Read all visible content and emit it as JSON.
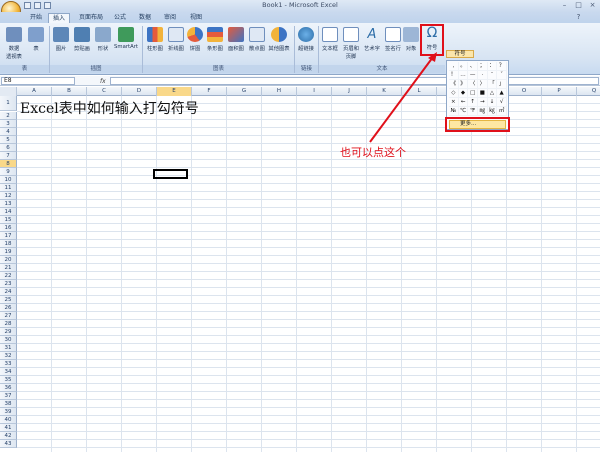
{
  "window": {
    "title": "Book1 - Microsoft Excel"
  },
  "tabs": [
    "开始",
    "插入",
    "页面布局",
    "公式",
    "数据",
    "审阅",
    "视图"
  ],
  "active_tab": "插入",
  "ribbon": {
    "groups": {
      "tables": "表",
      "illustrations": "插图",
      "charts": "图表",
      "links": "链接",
      "text": "文本"
    },
    "buttons": {
      "pivot": "数据\n透视表",
      "table": "表",
      "picture": "图片",
      "clipart": "剪贴画",
      "shapes": "形状",
      "smartart": "SmartArt",
      "column": "柱形图",
      "line": "折线图",
      "pie": "饼图",
      "bar": "条形图",
      "area": "面积图",
      "scatter": "散点图",
      "other_charts": "其他图表",
      "hyperlink": "超链接",
      "textbox": "文本框",
      "header_footer": "页眉和\n页脚",
      "wordart": "艺术字",
      "signature": "签名行",
      "object": "对象",
      "symbol": "符号"
    },
    "symbol_header": "符号"
  },
  "formula_bar": {
    "name_box": "E8",
    "fx": "fx",
    "value": ""
  },
  "columns": [
    "A",
    "B",
    "C",
    "D",
    "E",
    "F",
    "G",
    "H",
    "I",
    "J",
    "K",
    "L",
    "M",
    "N",
    "O",
    "P",
    "Q"
  ],
  "selected_column": "E",
  "rows": [
    "1",
    "2",
    "3",
    "4",
    "5",
    "6",
    "7",
    "8",
    "9",
    "10",
    "11",
    "12",
    "13",
    "14",
    "15",
    "16",
    "17",
    "18",
    "19",
    "20",
    "21",
    "22",
    "23",
    "24",
    "25",
    "26",
    "27",
    "28",
    "29",
    "30",
    "31",
    "32",
    "33",
    "34",
    "35",
    "36",
    "37",
    "38",
    "39",
    "40",
    "41",
    "42",
    "43"
  ],
  "selected_row": "8",
  "cells": {
    "A1": "Excel表中如何输入打勾符号"
  },
  "symbol_menu": {
    "symbols": [
      ",",
      "。",
      "、",
      "；",
      "：",
      "？",
      "！",
      "…",
      "—",
      "·",
      "ˉ",
      "ˇ",
      "《",
      "》",
      "〈",
      "〉",
      "「",
      "」",
      "◇",
      "◆",
      "□",
      "■",
      "△",
      "▲",
      "×",
      "←",
      "↑",
      "→",
      "↓",
      "√",
      "№",
      "℃",
      "℉",
      "㎎",
      "㎏",
      "㎡"
    ],
    "more_label": "更多..."
  },
  "annotation": "也可以点这个",
  "colors": {
    "accent": "#e0101a",
    "selected_header": "#f9d889",
    "ribbon": "#d7e4f3"
  }
}
